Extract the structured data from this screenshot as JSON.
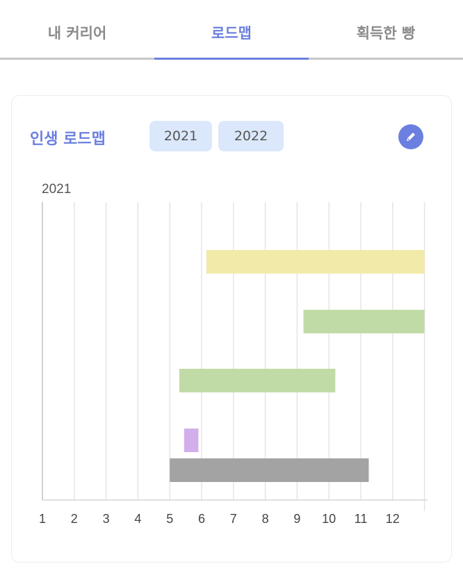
{
  "tabs": [
    {
      "label": "내 커리어",
      "active": false
    },
    {
      "label": "로드맵",
      "active": true
    },
    {
      "label": "획득한 빵",
      "active": false
    }
  ],
  "card": {
    "title": "인생 로드맵",
    "year_buttons": [
      "2021",
      "2022"
    ],
    "edit_icon": "pencil-icon"
  },
  "colors": {
    "accent": "#6b7fe0",
    "year_button_bg": "#dbe8fb"
  },
  "chart_data": {
    "type": "bar",
    "orientation": "horizontal",
    "title": "2021",
    "x_ticks": [
      "1",
      "2",
      "3",
      "4",
      "5",
      "6",
      "7",
      "8",
      "9",
      "10",
      "11",
      "12"
    ],
    "xlim": [
      1,
      13
    ],
    "grid": true,
    "bars": [
      {
        "start": 6.15,
        "end": 13.0,
        "color": "#f2eaa8"
      },
      {
        "start": 9.2,
        "end": 13.0,
        "color": "#c1dba6"
      },
      {
        "start": 5.3,
        "end": 10.2,
        "color": "#c1dba6"
      },
      {
        "start": 5.45,
        "end": 5.9,
        "color": "#d2aeea"
      },
      {
        "start": 5.0,
        "end": 11.25,
        "color": "#a3a3a3"
      }
    ]
  }
}
